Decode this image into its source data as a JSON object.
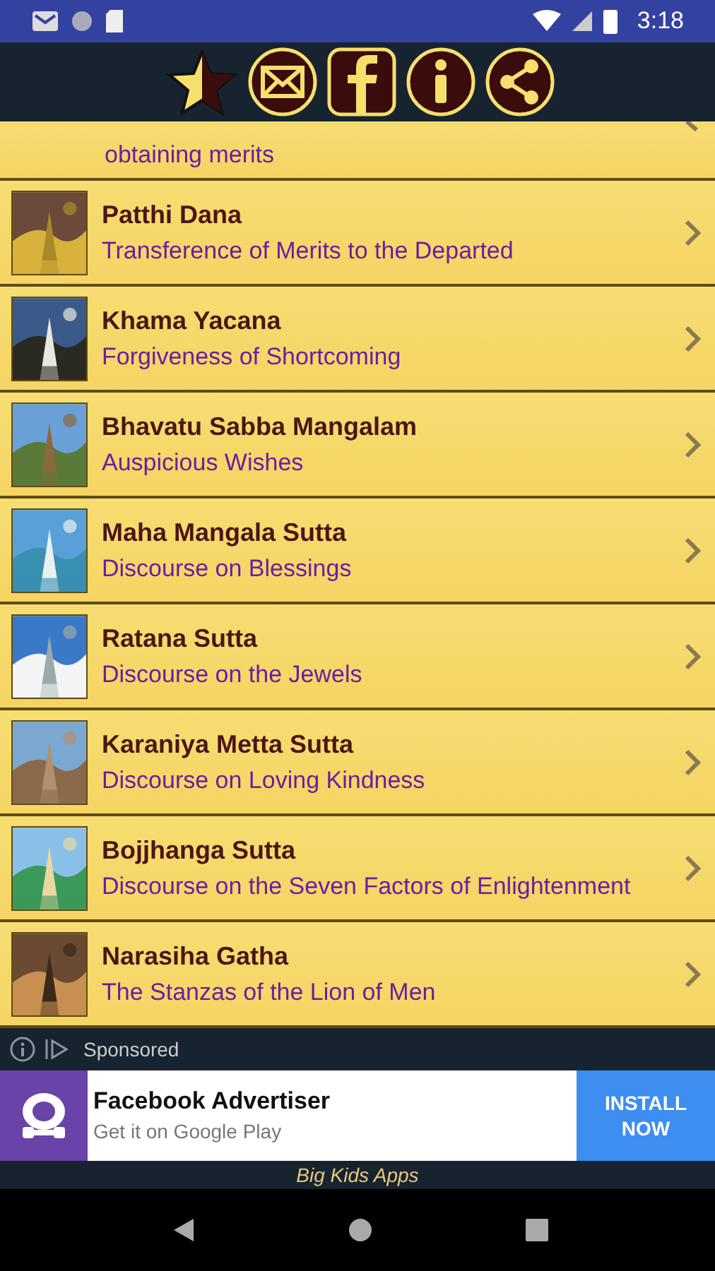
{
  "status_bar": {
    "time": "3:18"
  },
  "partial_item": {
    "subtitle": "obtaining merits"
  },
  "items": [
    {
      "title": "Patthi Dana",
      "subtitle": "Transference of Merits to the Departed",
      "kind": "picture"
    },
    {
      "title": "Khama Yacana",
      "subtitle": "Forgiveness of Shortcoming",
      "kind": "picture"
    },
    {
      "title": "Bhavatu Sabba Mangalam",
      "subtitle": "Auspicious Wishes",
      "kind": "picture"
    },
    {
      "title": "Maha Mangala Sutta",
      "subtitle": "Discourse on Blessings",
      "kind": "picture"
    },
    {
      "title": "Ratana Sutta",
      "subtitle": "Discourse on the Jewels",
      "kind": "picture"
    },
    {
      "title": "Karaniya Metta Sutta",
      "subtitle": "Discourse on Loving Kindness",
      "kind": "picture"
    },
    {
      "title": "Bojjhanga Sutta",
      "subtitle": "Discourse on the Seven Factors of Enlightenment",
      "kind": "picture"
    },
    {
      "title": "Narasiha Gatha",
      "subtitle": "The Stanzas of the Lion of Men",
      "kind": "picture"
    }
  ],
  "ad": {
    "label": "Sponsored",
    "title": "Facebook Advertiser",
    "subtitle": "Get it on Google Play",
    "button": "INSTALL NOW"
  },
  "footer": "Big Kids Apps"
}
